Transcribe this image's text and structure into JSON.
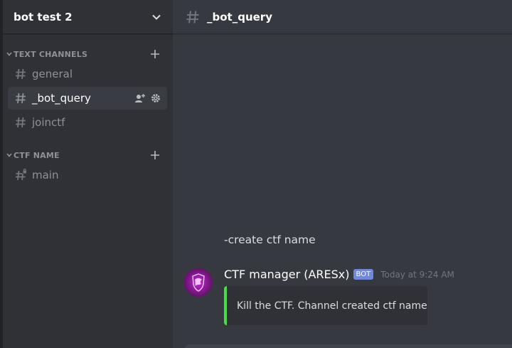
{
  "server": {
    "name": "bot test 2"
  },
  "categories": [
    {
      "label": "TEXT CHANNELS"
    },
    {
      "label": "CTF NAME"
    }
  ],
  "channels": {
    "general": "general",
    "bot_query": "_bot_query",
    "joinctf": "joinctf",
    "main": "main"
  },
  "header": {
    "channel": "_bot_query"
  },
  "messages": {
    "plain": "-create ctf name",
    "author": "CTF manager (ARESx)",
    "bot_tag": "BOT",
    "timestamp": "Today at 9:24 AM",
    "embed_text": "Kill the CTF. Channel created ctf name"
  },
  "colors": {
    "accent_bot": "#7289da",
    "embed_bar": "#43e043",
    "avatar": "#c02bd0"
  }
}
